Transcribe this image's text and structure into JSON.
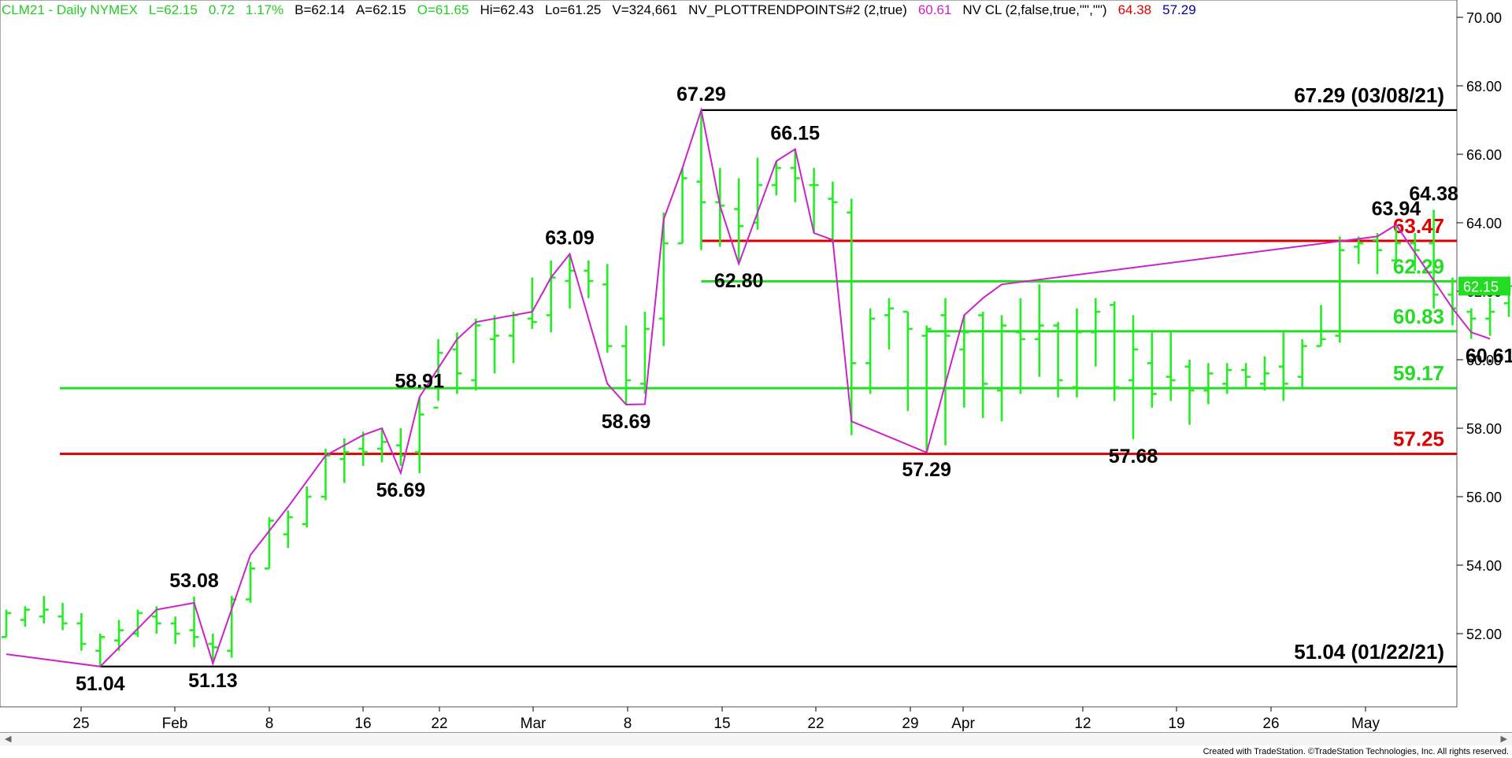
{
  "header": {
    "symbol": "CLM21 - Daily  NYMEX",
    "last": "L=62.15",
    "change": "0.72",
    "pct": "1.17%",
    "bid": "B=62.14",
    "ask": "A=62.15",
    "open": "O=61.65",
    "high": "Hi=62.43",
    "low": "Lo=61.25",
    "volume": "V=324,661",
    "indicator1": "NV_PLOTTRENDPOINTS#2 (2,true)",
    "indicator1_value": "60.61",
    "indicator2": "NV CL (2,false,true,\"\",\"\")",
    "indicator2_value1": "64.38",
    "indicator2_value2": "57.29"
  },
  "colors": {
    "bars": "#22ee22",
    "trend": "#cc22cc",
    "support_green": "#22dd22",
    "resistance_red": "#dd0000",
    "range_black": "#000000",
    "header_green": "#22cc22",
    "header_magenta": "#cc22cc",
    "header_red": "#dd0000",
    "header_blue": "#000099"
  },
  "footer": {
    "credit": "Created with TradeStation. ©TradeStation Technologies, Inc. All rights reserved."
  },
  "chart_data": {
    "type": "ohlc",
    "ylim": [
      49.5,
      70.5
    ],
    "y_ticks": [
      "70.00",
      "68.00",
      "66.00",
      "64.00",
      "62.00",
      "60.00",
      "58.00",
      "56.00",
      "54.00",
      "52.00"
    ],
    "x_ticks": [
      "25",
      "Feb",
      "8",
      "16",
      "22",
      "Mar",
      "8",
      "15",
      "22",
      "29",
      "Apr",
      "12",
      "19",
      "26",
      "May"
    ],
    "last_price_label": "62.15",
    "bars": [
      {
        "x": "Jan 14",
        "o": 51.9,
        "h": 52.7,
        "l": 51.9,
        "c": 52.6
      },
      {
        "x": "Jan 15",
        "o": 52.4,
        "h": 52.8,
        "l": 52.2,
        "c": 52.7
      },
      {
        "x": "Jan 19",
        "o": 52.5,
        "h": 53.1,
        "l": 52.3,
        "c": 52.7
      },
      {
        "x": "Jan 20",
        "o": 52.5,
        "h": 52.9,
        "l": 52.1,
        "c": 52.3
      },
      {
        "x": "Jan 21",
        "o": 52.3,
        "h": 52.6,
        "l": 51.5,
        "c": 51.7
      },
      {
        "x": "Jan 22",
        "o": 51.5,
        "h": 52.0,
        "l": 51.04,
        "c": 51.9
      },
      {
        "x": "Jan 25",
        "o": 51.8,
        "h": 52.4,
        "l": 51.5,
        "c": 52.1
      },
      {
        "x": "Jan 26",
        "o": 52.0,
        "h": 52.7,
        "l": 51.9,
        "c": 52.6
      },
      {
        "x": "Jan 27",
        "o": 52.5,
        "h": 52.8,
        "l": 52.0,
        "c": 52.3
      },
      {
        "x": "Jan 28",
        "o": 52.3,
        "h": 52.5,
        "l": 51.7,
        "c": 52.0
      },
      {
        "x": "Jan 29",
        "o": 52.1,
        "h": 53.08,
        "l": 51.6,
        "c": 51.9
      },
      {
        "x": "Feb 1",
        "o": 51.7,
        "h": 52.0,
        "l": 51.13,
        "c": 51.6
      },
      {
        "x": "Feb 2",
        "o": 51.5,
        "h": 53.1,
        "l": 51.3,
        "c": 53.0
      },
      {
        "x": "Feb 3",
        "o": 53.0,
        "h": 54.1,
        "l": 52.9,
        "c": 53.9
      },
      {
        "x": "Feb 4",
        "o": 53.9,
        "h": 55.4,
        "l": 53.9,
        "c": 55.3
      },
      {
        "x": "Feb 5",
        "o": 54.9,
        "h": 55.6,
        "l": 54.5,
        "c": 55.4
      },
      {
        "x": "Feb 8",
        "o": 55.2,
        "h": 56.3,
        "l": 55.1,
        "c": 56.0
      },
      {
        "x": "Feb 9",
        "o": 56.0,
        "h": 57.4,
        "l": 55.9,
        "c": 57.2
      },
      {
        "x": "Feb 10",
        "o": 57.1,
        "h": 57.7,
        "l": 56.4,
        "c": 57.3
      },
      {
        "x": "Feb 11",
        "o": 57.4,
        "h": 57.9,
        "l": 56.9,
        "c": 57.3
      },
      {
        "x": "Feb 12",
        "o": 57.4,
        "h": 58.0,
        "l": 57.0,
        "c": 57.6
      },
      {
        "x": "Feb 16",
        "o": 57.5,
        "h": 58.0,
        "l": 56.9,
        "c": 57.2
      },
      {
        "x": "Feb 17",
        "o": 57.3,
        "h": 58.91,
        "l": 56.69,
        "c": 58.4
      },
      {
        "x": "Feb 18",
        "o": 58.6,
        "h": 60.6,
        "l": 58.8,
        "c": 60.2
      },
      {
        "x": "Feb 19",
        "o": 60.3,
        "h": 60.8,
        "l": 59.0,
        "c": 59.6
      },
      {
        "x": "Feb 22",
        "o": 59.4,
        "h": 61.2,
        "l": 59.1,
        "c": 61.0
      },
      {
        "x": "Feb 23",
        "o": 60.6,
        "h": 61.3,
        "l": 59.6,
        "c": 60.7
      },
      {
        "x": "Feb 24",
        "o": 60.7,
        "h": 61.4,
        "l": 59.9,
        "c": 61.3
      },
      {
        "x": "Feb 25",
        "o": 61.2,
        "h": 62.4,
        "l": 60.9,
        "c": 61.1
      },
      {
        "x": "Feb 26",
        "o": 61.3,
        "h": 62.9,
        "l": 60.8,
        "c": 62.4
      },
      {
        "x": "Mar 1",
        "o": 62.3,
        "h": 63.09,
        "l": 61.5,
        "c": 62.6
      },
      {
        "x": "Mar 2",
        "o": 62.6,
        "h": 62.9,
        "l": 61.8,
        "c": 62.3
      },
      {
        "x": "Mar 3",
        "o": 62.2,
        "h": 62.8,
        "l": 60.2,
        "c": 60.4
      },
      {
        "x": "Mar 4",
        "o": 60.4,
        "h": 61.0,
        "l": 58.69,
        "c": 59.4
      },
      {
        "x": "Mar 5",
        "o": 59.3,
        "h": 61.4,
        "l": 59.0,
        "c": 60.9
      },
      {
        "x": "Mar 8",
        "o": 61.2,
        "h": 64.3,
        "l": 60.4,
        "c": 63.4
      },
      {
        "x": "Mar 9",
        "o": 63.4,
        "h": 65.6,
        "l": 63.4,
        "c": 65.3
      },
      {
        "x": "Mar 10",
        "o": 65.2,
        "h": 67.29,
        "l": 63.2,
        "c": 64.6
      },
      {
        "x": "Mar 11",
        "o": 64.6,
        "h": 65.6,
        "l": 63.3,
        "c": 64.5
      },
      {
        "x": "Mar 12",
        "o": 64.4,
        "h": 65.3,
        "l": 62.8,
        "c": 63.9
      },
      {
        "x": "Mar 15",
        "o": 64.0,
        "h": 65.9,
        "l": 63.8,
        "c": 65.1
      },
      {
        "x": "Mar 16",
        "o": 65.1,
        "h": 65.8,
        "l": 64.8,
        "c": 65.6
      },
      {
        "x": "Mar 17",
        "o": 65.6,
        "h": 66.15,
        "l": 64.6,
        "c": 65.3
      },
      {
        "x": "Mar 18",
        "o": 65.1,
        "h": 65.6,
        "l": 63.7,
        "c": 65.1
      },
      {
        "x": "Mar 19",
        "o": 64.7,
        "h": 65.2,
        "l": 63.4,
        "c": 64.6
      },
      {
        "x": "Mar 22",
        "o": 64.3,
        "h": 64.7,
        "l": 57.8,
        "c": 59.9
      },
      {
        "x": "Mar 23",
        "o": 59.9,
        "h": 61.5,
        "l": 59.0,
        "c": 61.2
      },
      {
        "x": "Mar 24",
        "o": 61.3,
        "h": 61.8,
        "l": 60.3,
        "c": 61.5
      },
      {
        "x": "Mar 25",
        "o": 61.4,
        "h": 61.4,
        "l": 58.5,
        "c": 60.9
      },
      {
        "x": "Mar 26",
        "o": 60.7,
        "h": 61.0,
        "l": 57.29,
        "c": 60.9
      },
      {
        "x": "Mar 29",
        "o": 61.3,
        "h": 61.8,
        "l": 57.5,
        "c": 60.7
      },
      {
        "x": "Mar 30",
        "o": 60.3,
        "h": 61.3,
        "l": 58.6,
        "c": 60.8
      },
      {
        "x": "Mar 31",
        "o": 61.3,
        "h": 61.4,
        "l": 58.3,
        "c": 59.3
      },
      {
        "x": "Apr 1",
        "o": 59.1,
        "h": 61.3,
        "l": 58.2,
        "c": 61.0
      },
      {
        "x": "Apr 5",
        "o": 60.8,
        "h": 61.8,
        "l": 59.0,
        "c": 60.6
      },
      {
        "x": "Apr 6",
        "o": 60.6,
        "h": 62.2,
        "l": 59.5,
        "c": 61.0
      },
      {
        "x": "Apr 7",
        "o": 61.0,
        "h": 61.1,
        "l": 58.9,
        "c": 59.4
      },
      {
        "x": "Apr 8",
        "o": 59.2,
        "h": 61.5,
        "l": 58.9,
        "c": 60.8
      },
      {
        "x": "Apr 9",
        "o": 60.8,
        "h": 61.8,
        "l": 59.8,
        "c": 61.4
      },
      {
        "x": "Apr 12",
        "o": 61.6,
        "h": 61.7,
        "l": 58.8,
        "c": 59.2
      },
      {
        "x": "Apr 13",
        "o": 59.4,
        "h": 61.3,
        "l": 57.68,
        "c": 60.3
      },
      {
        "x": "Apr 14",
        "o": 59.9,
        "h": 60.8,
        "l": 58.6,
        "c": 59.0
      },
      {
        "x": "Apr 15",
        "o": 59.5,
        "h": 60.8,
        "l": 58.8,
        "c": 59.4
      },
      {
        "x": "Apr 16",
        "o": 59.8,
        "h": 60.0,
        "l": 58.1,
        "c": 59.1
      },
      {
        "x": "Apr 19",
        "o": 59.1,
        "h": 59.9,
        "l": 58.7,
        "c": 59.6
      },
      {
        "x": "Apr 20",
        "o": 59.3,
        "h": 59.9,
        "l": 59.0,
        "c": 59.7
      },
      {
        "x": "Apr 21",
        "o": 59.7,
        "h": 59.9,
        "l": 59.2,
        "c": 59.5
      },
      {
        "x": "Apr 22",
        "o": 59.3,
        "h": 60.1,
        "l": 59.1,
        "c": 59.6
      },
      {
        "x": "Apr 23",
        "o": 59.8,
        "h": 60.8,
        "l": 58.8,
        "c": 59.3
      },
      {
        "x": "Apr 26",
        "o": 59.5,
        "h": 60.6,
        "l": 59.2,
        "c": 60.4
      },
      {
        "x": "Apr 27",
        "o": 60.4,
        "h": 61.6,
        "l": 60.4,
        "c": 60.6
      },
      {
        "x": "Apr 28",
        "o": 60.7,
        "h": 63.6,
        "l": 60.5,
        "c": 63.2
      },
      {
        "x": "Apr 29",
        "o": 63.3,
        "h": 63.6,
        "l": 62.8,
        "c": 63.4
      },
      {
        "x": "Apr 30",
        "o": 63.5,
        "h": 63.7,
        "l": 62.5,
        "c": 63.2
      },
      {
        "x": "May 3",
        "o": 62.9,
        "h": 63.94,
        "l": 62.9,
        "c": 63.4
      },
      {
        "x": "May 4",
        "o": 63.4,
        "h": 63.7,
        "l": 62.6,
        "c": 63.2
      },
      {
        "x": "May 5",
        "o": 63.4,
        "h": 64.38,
        "l": 61.5,
        "c": 61.9
      },
      {
        "x": "May 6",
        "o": 61.9,
        "h": 62.4,
        "l": 61.0,
        "c": 61.5
      },
      {
        "x": "May 7",
        "o": 61.4,
        "h": 61.5,
        "l": 60.61,
        "c": 61.2
      },
      {
        "x": "May 10",
        "o": 61.2,
        "h": 61.8,
        "l": 60.7,
        "c": 61.4
      },
      {
        "x": "May 11",
        "o": 61.65,
        "h": 62.43,
        "l": 61.25,
        "c": 62.15
      }
    ],
    "trend_points": [
      {
        "x": "Jan 14",
        "y": 51.4
      },
      {
        "x": "Jan 22",
        "y": 51.04
      },
      {
        "x": "Jan 27",
        "y": 52.7
      },
      {
        "x": "Jan 29",
        "y": 52.9
      },
      {
        "x": "Feb 1",
        "y": 51.13
      },
      {
        "x": "Feb 3",
        "y": 54.3
      },
      {
        "x": "Feb 5",
        "y": 55.7
      },
      {
        "x": "Feb 9",
        "y": 57.2
      },
      {
        "x": "Feb 11",
        "y": 57.8
      },
      {
        "x": "Feb 12",
        "y": 58.0
      },
      {
        "x": "Feb 16",
        "y": 56.69
      },
      {
        "x": "Feb 17",
        "y": 58.91
      },
      {
        "x": "Feb 19",
        "y": 60.6
      },
      {
        "x": "Feb 22",
        "y": 61.1
      },
      {
        "x": "Feb 25",
        "y": 61.4
      },
      {
        "x": "Feb 26",
        "y": 62.4
      },
      {
        "x": "Mar 1",
        "y": 63.09
      },
      {
        "x": "Mar 3",
        "y": 59.3
      },
      {
        "x": "Mar 4",
        "y": 58.69
      },
      {
        "x": "Mar 5",
        "y": 58.7
      },
      {
        "x": "Mar 8",
        "y": 64.1
      },
      {
        "x": "Mar 9",
        "y": 65.6
      },
      {
        "x": "Mar 10",
        "y": 67.29
      },
      {
        "x": "Mar 11",
        "y": 64.5
      },
      {
        "x": "Mar 12",
        "y": 62.8
      },
      {
        "x": "Mar 16",
        "y": 65.8
      },
      {
        "x": "Mar 17",
        "y": 66.15
      },
      {
        "x": "Mar 18",
        "y": 63.7
      },
      {
        "x": "Mar 19",
        "y": 63.5
      },
      {
        "x": "Mar 22",
        "y": 58.2
      },
      {
        "x": "Mar 26",
        "y": 57.29
      },
      {
        "x": "Mar 30",
        "y": 61.3
      },
      {
        "x": "Mar 31",
        "y": 61.8
      },
      {
        "x": "Apr 1",
        "y": 62.2
      },
      {
        "x": "Apr 30",
        "y": 63.6
      },
      {
        "x": "May 3",
        "y": 63.94
      },
      {
        "x": "May 6",
        "y": 61.5
      },
      {
        "x": "May 7",
        "y": 60.8
      },
      {
        "x": "May 10",
        "y": 60.61
      }
    ],
    "level_lines": [
      {
        "value": 67.29,
        "label": "67.29 (03/08/21)",
        "color": "#000000",
        "from": "Mar 10"
      },
      {
        "value": 63.47,
        "label": "63.47",
        "color": "#dd0000",
        "from": "Mar 10"
      },
      {
        "value": 62.29,
        "label": "62.29",
        "color": "#22dd22",
        "from": "Mar 10"
      },
      {
        "value": 60.83,
        "label": "60.83",
        "color": "#22dd22",
        "from": "Mar 26"
      },
      {
        "value": 59.17,
        "label": "59.17",
        "color": "#22dd22",
        "from": "Jan 19"
      },
      {
        "value": 57.25,
        "label": "57.25",
        "color": "#dd0000",
        "from": "Jan 19"
      },
      {
        "value": 51.04,
        "label": "51.04 (01/22/21)",
        "color": "#000000",
        "from": "Jan 22"
      }
    ],
    "annotations": [
      {
        "x": "Jan 22",
        "y": 51.04,
        "text": "51.04",
        "pos": "below"
      },
      {
        "x": "Feb 1",
        "y": 51.13,
        "text": "51.13",
        "pos": "below"
      },
      {
        "x": "Jan 29",
        "y": 53.08,
        "text": "53.08",
        "pos": "above"
      },
      {
        "x": "Feb 16",
        "y": 56.69,
        "text": "56.69",
        "pos": "below"
      },
      {
        "x": "Feb 17",
        "y": 58.91,
        "text": "58.91",
        "pos": "above"
      },
      {
        "x": "Mar 1",
        "y": 63.09,
        "text": "63.09",
        "pos": "above"
      },
      {
        "x": "Mar 4",
        "y": 58.69,
        "text": "58.69",
        "pos": "below"
      },
      {
        "x": "Mar 10",
        "y": 67.29,
        "text": "67.29",
        "pos": "above"
      },
      {
        "x": "Mar 12",
        "y": 62.8,
        "text": "62.80",
        "pos": "below"
      },
      {
        "x": "Mar 17",
        "y": 66.15,
        "text": "66.15",
        "pos": "above"
      },
      {
        "x": "Mar 26",
        "y": 57.29,
        "text": "57.29",
        "pos": "below"
      },
      {
        "x": "Apr 13",
        "y": 57.68,
        "text": "57.68",
        "pos": "below"
      },
      {
        "x": "May 3",
        "y": 63.94,
        "text": "63.94",
        "pos": "above"
      },
      {
        "x": "May 5",
        "y": 64.38,
        "text": "64.38",
        "pos": "above"
      },
      {
        "x": "May 10",
        "y": 60.61,
        "text": "60.61",
        "pos": "below"
      }
    ]
  }
}
